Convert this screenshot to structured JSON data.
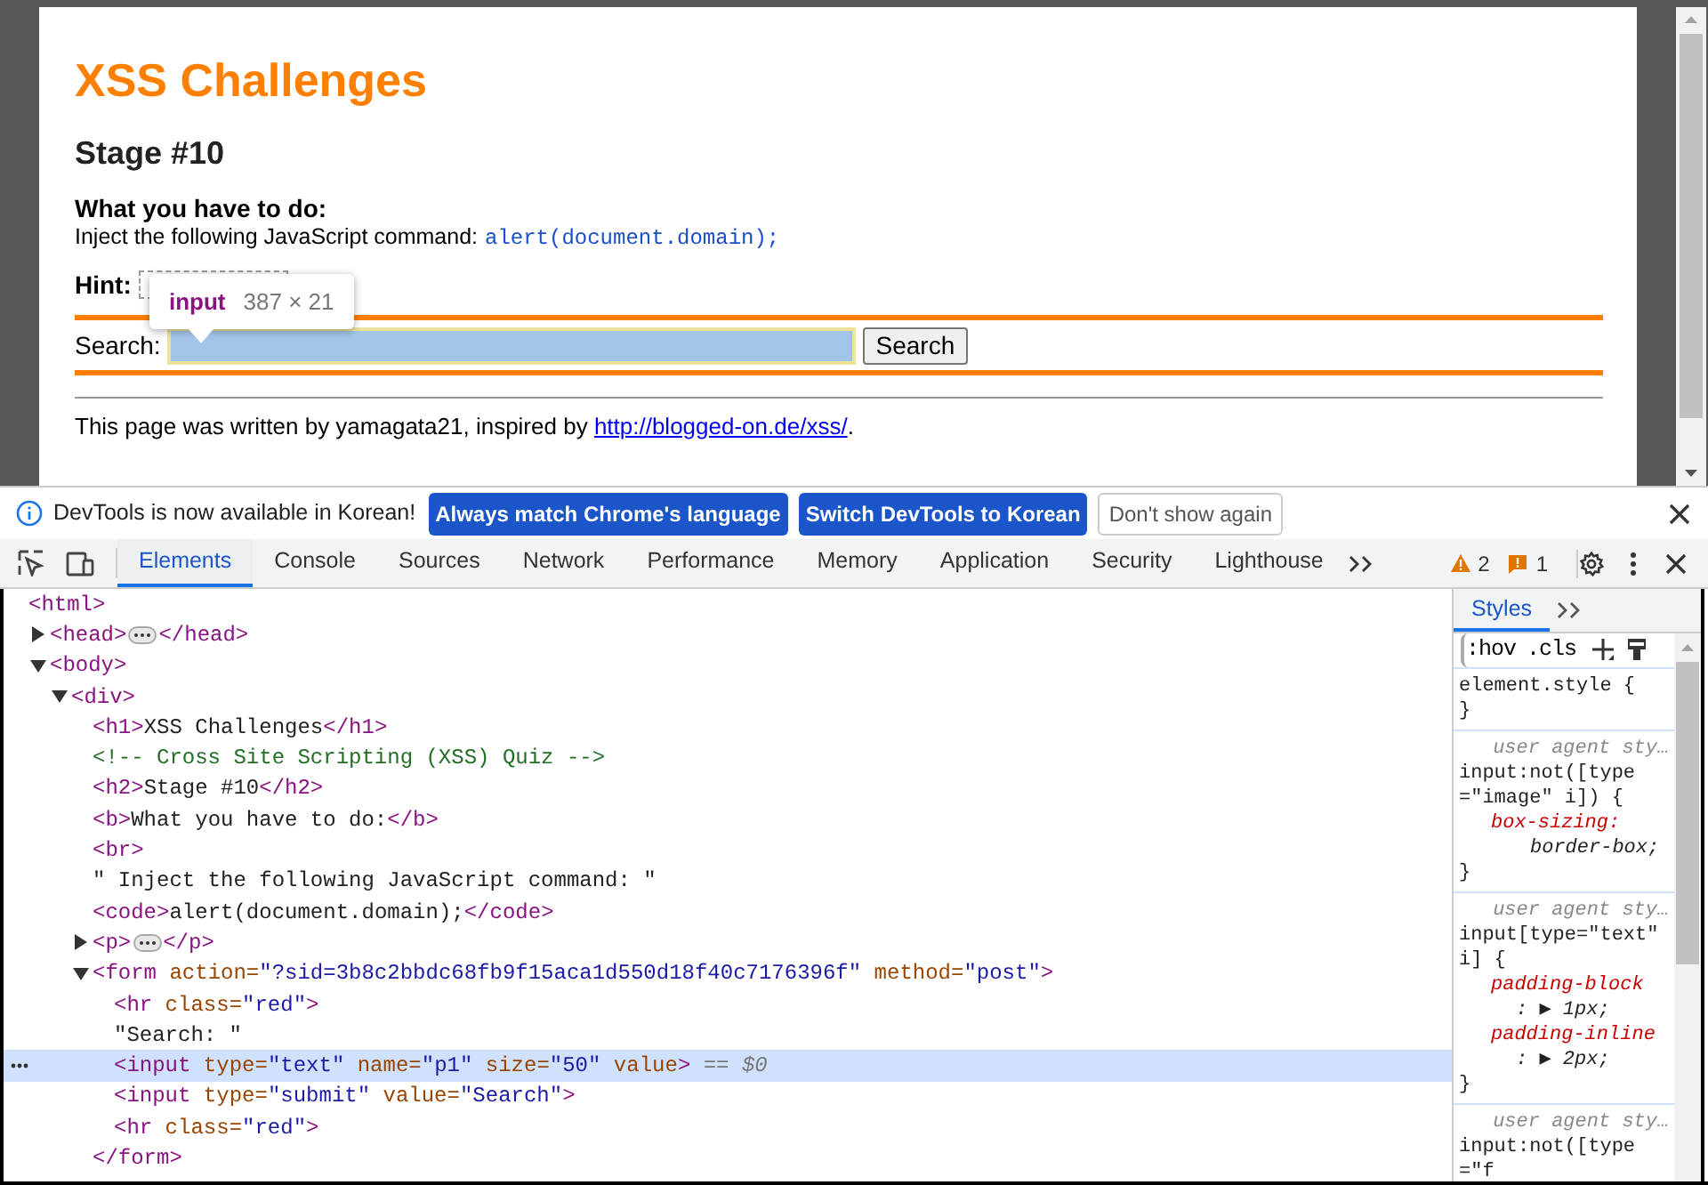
{
  "page": {
    "heading": "XSS Challenges",
    "stage": "Stage #10",
    "task_label": "What you have to do:",
    "task_text": "Inject the following JavaScript command:",
    "task_code": "alert(document.domain);",
    "hint_label": "Hint:",
    "search_label": "Search:",
    "search_button": "Search",
    "footer_text": "This page was written by yamagata21, inspired by ",
    "footer_link": "http://blogged-on.de/xss/",
    "footer_end": "."
  },
  "inspect_tooltip": {
    "tag": "input",
    "size": "387 × 21"
  },
  "infobar": {
    "message": "DevTools is now available in Korean!",
    "buttons": [
      {
        "label": "Always match Chrome's language",
        "kind": "primary"
      },
      {
        "label": "Switch DevTools to Korean",
        "kind": "primary"
      },
      {
        "label": "Don't show again",
        "kind": "secondary"
      }
    ]
  },
  "devtools": {
    "tabs": [
      {
        "label": "Elements",
        "selected": true
      },
      {
        "label": "Console",
        "selected": false
      },
      {
        "label": "Sources",
        "selected": false
      },
      {
        "label": "Network",
        "selected": false
      },
      {
        "label": "Performance",
        "selected": false
      },
      {
        "label": "Memory",
        "selected": false
      },
      {
        "label": "Application",
        "selected": false
      },
      {
        "label": "Security",
        "selected": false
      },
      {
        "label": "Lighthouse",
        "selected": false
      }
    ],
    "warnings": "2",
    "issues": "1",
    "dom_tree": [
      {
        "selected": false,
        "parts": [
          {
            "kind": "tag",
            "text": "<html>"
          }
        ],
        "children": [
          {
            "selected": false,
            "expanded": false,
            "parts": [
              {
                "kind": "tag",
                "text": "<head>"
              },
              {
                "kind": "ellipsis"
              },
              {
                "kind": "tag",
                "text": "</head>"
              }
            ]
          },
          {
            "selected": false,
            "expanded": true,
            "parts": [
              {
                "kind": "tag",
                "text": "<body>"
              }
            ],
            "children": [
              {
                "selected": false,
                "expanded": true,
                "parts": [
                  {
                    "kind": "tag",
                    "text": "<div>"
                  }
                ],
                "children": [
                  {
                    "selected": false,
                    "parts": [
                      {
                        "kind": "tag",
                        "text": "<h1>"
                      },
                      {
                        "kind": "text",
                        "text": "XSS Challenges"
                      },
                      {
                        "kind": "tag",
                        "text": "</h1>"
                      }
                    ]
                  },
                  {
                    "selected": false,
                    "parts": [
                      {
                        "kind": "comment",
                        "text": "<!-- Cross Site Scripting (XSS) Quiz -->"
                      }
                    ]
                  },
                  {
                    "selected": false,
                    "parts": [
                      {
                        "kind": "tag",
                        "text": "<h2>"
                      },
                      {
                        "kind": "text",
                        "text": "Stage #10"
                      },
                      {
                        "kind": "tag",
                        "text": "</h2>"
                      }
                    ]
                  },
                  {
                    "selected": false,
                    "parts": [
                      {
                        "kind": "tag",
                        "text": "<b>"
                      },
                      {
                        "kind": "text",
                        "text": "What you have to do:"
                      },
                      {
                        "kind": "tag",
                        "text": "</b>"
                      }
                    ]
                  },
                  {
                    "selected": false,
                    "parts": [
                      {
                        "kind": "tag",
                        "text": "<br>"
                      }
                    ]
                  },
                  {
                    "selected": false,
                    "parts": [
                      {
                        "kind": "text",
                        "text": "\" Inject the following JavaScript command: \""
                      }
                    ]
                  },
                  {
                    "selected": false,
                    "parts": [
                      {
                        "kind": "tag",
                        "text": "<code>"
                      },
                      {
                        "kind": "text",
                        "text": "alert(document.domain);"
                      },
                      {
                        "kind": "tag",
                        "text": "</code>"
                      }
                    ]
                  },
                  {
                    "selected": false,
                    "expanded": false,
                    "parts": [
                      {
                        "kind": "tag",
                        "text": "<p>"
                      },
                      {
                        "kind": "ellipsis"
                      },
                      {
                        "kind": "tag",
                        "text": "</p>"
                      }
                    ]
                  },
                  {
                    "selected": false,
                    "expanded": true,
                    "parts": [
                      {
                        "kind": "tag",
                        "text": "<form"
                      },
                      {
                        "kind": "attr",
                        "text": " action="
                      },
                      {
                        "kind": "value",
                        "text": "\"?sid=3b8c2bbdc68fb9f15aca1d550d18f40c7176396f\""
                      },
                      {
                        "kind": "attr",
                        "text": " method="
                      },
                      {
                        "kind": "value",
                        "text": "\"post\""
                      },
                      {
                        "kind": "tag",
                        "text": ">"
                      }
                    ],
                    "closing": [
                      {
                        "kind": "tag",
                        "text": "</form>"
                      }
                    ],
                    "children": [
                      {
                        "selected": false,
                        "parts": [
                          {
                            "kind": "tag",
                            "text": "<hr"
                          },
                          {
                            "kind": "attr",
                            "text": " class="
                          },
                          {
                            "kind": "value",
                            "text": "\"red\""
                          },
                          {
                            "kind": "tag",
                            "text": ">"
                          }
                        ]
                      },
                      {
                        "selected": false,
                        "parts": [
                          {
                            "kind": "text",
                            "text": "\"Search: \""
                          }
                        ]
                      },
                      {
                        "selected": true,
                        "parts": [
                          {
                            "kind": "tag",
                            "text": "<input"
                          },
                          {
                            "kind": "attr",
                            "text": " type="
                          },
                          {
                            "kind": "value",
                            "text": "\"text\""
                          },
                          {
                            "kind": "attr",
                            "text": " name="
                          },
                          {
                            "kind": "value",
                            "text": "\"p1\""
                          },
                          {
                            "kind": "attr",
                            "text": " size="
                          },
                          {
                            "kind": "value",
                            "text": "\"50\""
                          },
                          {
                            "kind": "attr",
                            "text": " value"
                          },
                          {
                            "kind": "tag",
                            "text": ">"
                          },
                          {
                            "kind": "marker",
                            "text": " == $0"
                          }
                        ]
                      },
                      {
                        "selected": false,
                        "parts": [
                          {
                            "kind": "tag",
                            "text": "<input"
                          },
                          {
                            "kind": "attr",
                            "text": " type="
                          },
                          {
                            "kind": "value",
                            "text": "\"submit\""
                          },
                          {
                            "kind": "attr",
                            "text": " value="
                          },
                          {
                            "kind": "value",
                            "text": "\"Search\""
                          },
                          {
                            "kind": "tag",
                            "text": ">"
                          }
                        ]
                      },
                      {
                        "selected": false,
                        "parts": [
                          {
                            "kind": "tag",
                            "text": "<hr"
                          },
                          {
                            "kind": "attr",
                            "text": " class="
                          },
                          {
                            "kind": "value",
                            "text": "\"red\""
                          },
                          {
                            "kind": "tag",
                            "text": ">"
                          }
                        ]
                      }
                    ]
                  }
                ]
              }
            ]
          }
        ]
      }
    ],
    "styles_tabs": [
      {
        "label": "Styles",
        "selected": true
      }
    ],
    "styles_filters": [
      ":hov",
      ".cls"
    ],
    "rules": [
      {
        "selector": "element.style {",
        "close": "}"
      },
      {
        "origin": "user agent sty…",
        "selector": "input:not([type=\"image\" i]) {",
        "declarations": [
          {
            "name": "box-sizing:",
            "value": "border-box;",
            "expandable": false
          }
        ],
        "close": "}"
      },
      {
        "origin": "user agent sty…",
        "selector": "input[type=\"text\" i] {",
        "declarations": [
          {
            "name": "padding-block",
            "value": ": ▶ 1px;",
            "expandable": true
          },
          {
            "name": "padding-inline",
            "value": ": ▶ 2px;",
            "expandable": true
          }
        ],
        "close": "}"
      },
      {
        "origin": "user agent sty…",
        "selector": "input:not([type=\"f"
      }
    ]
  }
}
